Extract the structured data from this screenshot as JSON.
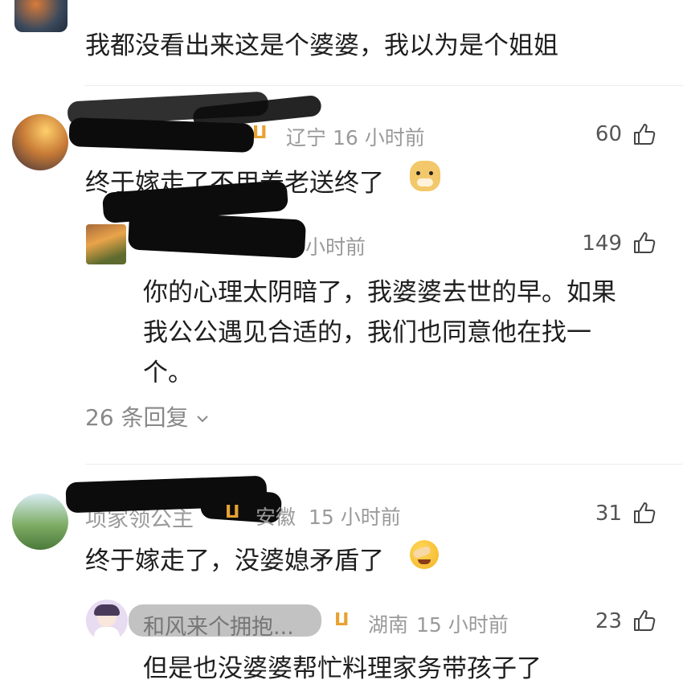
{
  "comments": [
    {
      "name": "",
      "text": "我都没看出来这是个婆婆，我以为是个姐姐"
    },
    {
      "name": "",
      "location": "辽宁",
      "time": "16 小时前",
      "likes": "60",
      "text": "终于嫁走了不用养老送终了",
      "emoji": "doge-emoji",
      "reply": {
        "name": "",
        "time": "小时前",
        "likes": "149",
        "text_lines": [
          "你的心理太阴暗了，我婆婆去世的早。如果",
          "我公公遇见合适的，我们也同意他在找一",
          "个。"
        ],
        "more_replies": "26 条回复"
      }
    },
    {
      "name": "项家领公主",
      "location": "安徽",
      "time": "15 小时前",
      "likes": "31",
      "text": "终于嫁走了，没婆媳矛盾了",
      "emoji": "facepalm-laugh-emoji",
      "reply": {
        "name": "和风来个拥抱...",
        "location": "湖南",
        "time": "15 小时前",
        "likes": "23",
        "text": "但是也没婆婆帮忙料理家务带孩子了"
      }
    }
  ],
  "colors": {
    "text": "#1e1e1e",
    "meta": "#9a9a9a",
    "vip_badge": "#e8a232",
    "divider": "#ececec"
  },
  "icons": {
    "like": "thumbs-up-icon",
    "chevron": "chevron-down-icon",
    "vip": "vip-badge-icon"
  }
}
